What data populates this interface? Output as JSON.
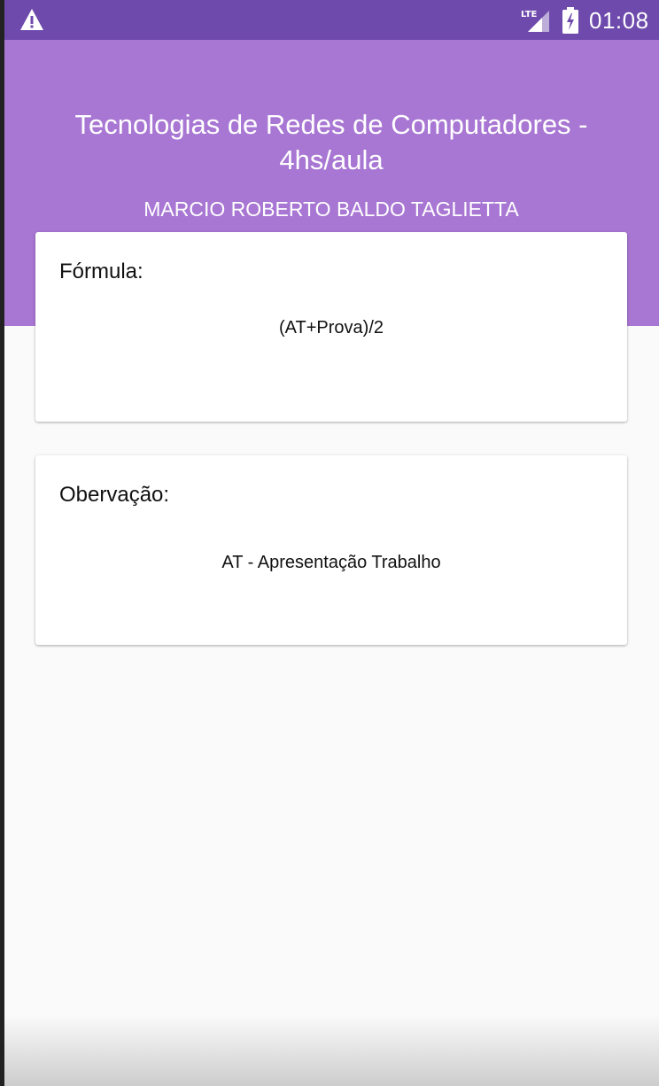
{
  "status_bar": {
    "time": "01:08",
    "network": "LTE",
    "icons": [
      "warning-icon",
      "lte-signal-icon",
      "battery-charging-icon"
    ]
  },
  "header": {
    "title": "Tecnologias de Redes de Computadores - 4hs/aula",
    "teacher": "MARCIO ROBERTO BALDO TAGLIETTA"
  },
  "cards": {
    "formula": {
      "label": "Fórmula:",
      "value": "(AT+Prova)/2"
    },
    "note": {
      "label": "Obervação:",
      "value": "AT - Apresentação Trabalho"
    }
  },
  "colors": {
    "status_bar": "#6e4aac",
    "header": "#a876d3",
    "background": "#fafafa",
    "card": "#ffffff"
  }
}
